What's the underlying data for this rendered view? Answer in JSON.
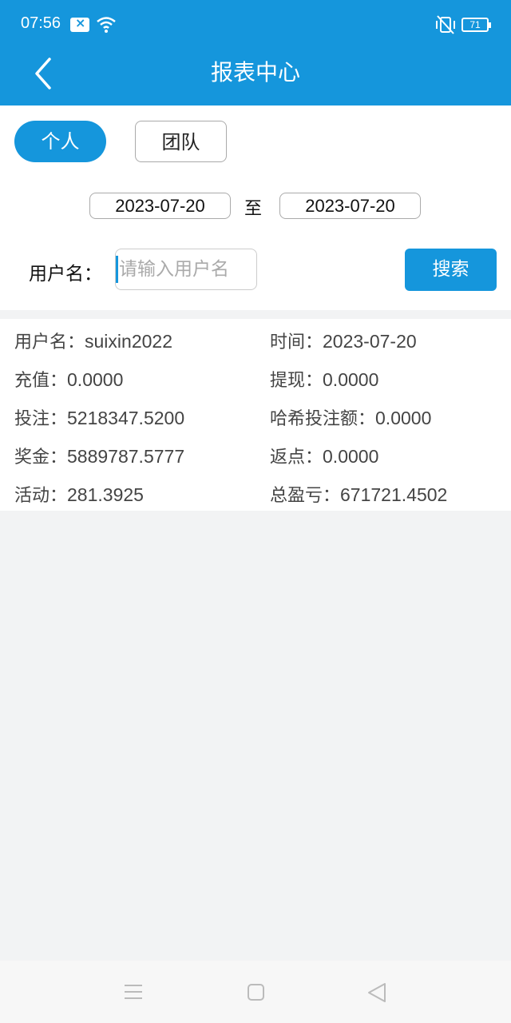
{
  "status_bar": {
    "time": "07:56",
    "battery": "71"
  },
  "header": {
    "title": "报表中心"
  },
  "tabs": {
    "personal": "个人",
    "team": "团队"
  },
  "date_range": {
    "start": "2023-07-20",
    "separator": "至",
    "end": "2023-07-20"
  },
  "search": {
    "label": "用户名：",
    "placeholder": "请输入用户名",
    "button": "搜索"
  },
  "report": {
    "username_label": "用户名：",
    "username": "suixin2022",
    "time_label": "时间：",
    "time": "2023-07-20",
    "recharge_label": "充值：",
    "recharge": "0.0000",
    "withdraw_label": "提现：",
    "withdraw": "0.0000",
    "bet_label": "投注：",
    "bet": "5218347.5200",
    "hash_bet_label": "哈希投注额：",
    "hash_bet": "0.0000",
    "bonus_label": "奖金：",
    "bonus": "5889787.5777",
    "rebate_label": "返点：",
    "rebate": "0.0000",
    "activity_label": "活动：",
    "activity": "281.3925",
    "total_label": "总盈亏：",
    "total": "671721.4502"
  },
  "colors": {
    "primary": "#1596dc"
  }
}
